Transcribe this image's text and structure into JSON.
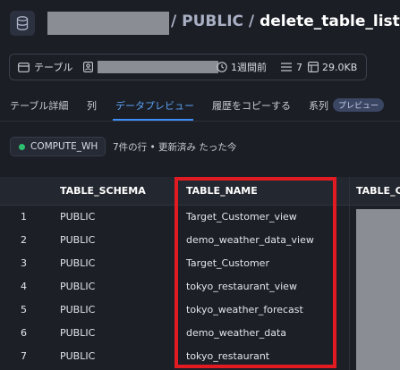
{
  "header": {
    "separator": "/",
    "schema": "PUBLIC",
    "table": "delete_table_list"
  },
  "meta": {
    "type_label": "テーブル",
    "updated": "1週間前",
    "rows": "7",
    "size": "29.0KB"
  },
  "tabs": [
    {
      "label": "テーブル詳細"
    },
    {
      "label": "列"
    },
    {
      "label": "データプレビュー",
      "active": true
    },
    {
      "label": "履歴をコピーする"
    },
    {
      "label": "系列",
      "badge": "プレビュー"
    }
  ],
  "status": {
    "warehouse": "COMPUTE_WH",
    "summary": "7件の行 • 更新済み たった今"
  },
  "table": {
    "columns": [
      "TABLE_SCHEMA",
      "TABLE_NAME",
      "TABLE_C"
    ],
    "rows": [
      {
        "n": "1",
        "schema": "PUBLIC",
        "name": "Target_Customer_view"
      },
      {
        "n": "2",
        "schema": "PUBLIC",
        "name": "demo_weather_data_view"
      },
      {
        "n": "3",
        "schema": "PUBLIC",
        "name": "Target_Customer"
      },
      {
        "n": "4",
        "schema": "PUBLIC",
        "name": "tokyo_restaurant_view"
      },
      {
        "n": "5",
        "schema": "PUBLIC",
        "name": "tokyo_weather_forecast"
      },
      {
        "n": "6",
        "schema": "PUBLIC",
        "name": "demo_weather_data"
      },
      {
        "n": "7",
        "schema": "PUBLIC",
        "name": "tokyo_restaurant"
      }
    ]
  },
  "colors": {
    "accent": "#3e8ef7",
    "highlight": "#e21b22",
    "warehouse_dot": "#2fbf71"
  }
}
